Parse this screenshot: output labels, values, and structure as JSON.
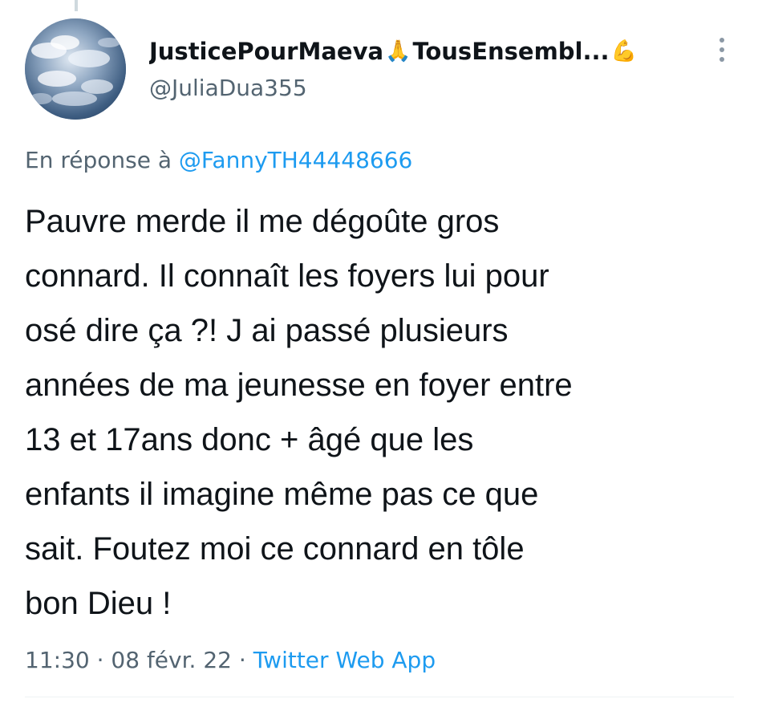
{
  "tweet": {
    "display_name": "JusticePourMaeva",
    "display_name_emoji": "🙏",
    "display_name_suffix": "TousEnsembl...",
    "display_name_trailing_emoji": "💪",
    "handle": "@JuliaDua355",
    "reply_prefix": "En réponse à",
    "reply_mention": "@FannyTH44448666",
    "text": "Pauvre merde il me dégoûte gros\nconnard. Il connaît les foyers lui pour\nosé dire ça ?! J ai passé plusieurs\nannées de ma jeunesse en foyer entre\n13 et 17ans donc + âgé que les\nenfants il imagine même pas ce que\nsait. Foutez moi ce connard en tôle\nbon Dieu !",
    "time": "11:30",
    "separator": "·",
    "date": "08 févr. 22",
    "source": "Twitter Web App"
  },
  "icons": {
    "more": "more-vertical-icon",
    "avatar": "sky-clouds-avatar"
  },
  "colors": {
    "link": "#1d9bf0",
    "secondary_text": "#536471",
    "primary_text": "#0f1419"
  }
}
